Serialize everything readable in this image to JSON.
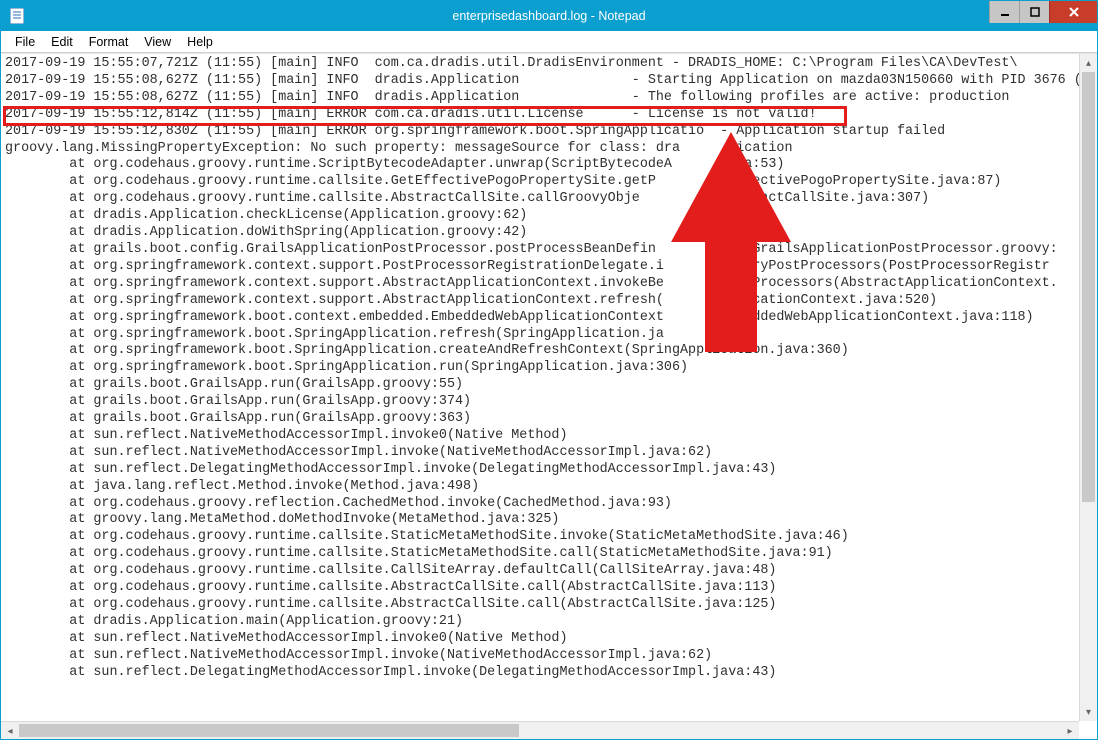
{
  "window": {
    "title": "enterprisedashboard.log - Notepad"
  },
  "menu": {
    "file": "File",
    "edit": "Edit",
    "format": "Format",
    "view": "View",
    "help": "Help"
  },
  "log": {
    "L1": "2017-09-19 15:55:07,721Z (11:55) [main] INFO  com.ca.dradis.util.DradisEnvironment - DRADIS_HOME: C:\\Program Files\\CA\\DevTest\\",
    "L2": "2017-09-19 15:55:08,627Z (11:55) [main] INFO  dradis.Application              - Starting Application on mazda03N150660 with PID 3676 (",
    "L3": "2017-09-19 15:55:08,627Z (11:55) [main] INFO  dradis.Application              - The following profiles are active: production",
    "L4": "2017-09-19 15:55:12,814Z (11:55) [main] ERROR com.ca.dradis.util.License      - License is not valid!",
    "L5": "2017-09-19 15:55:12,830Z (11:55) [main] ERROR org.springframework.boot.SpringApplicatio  - Application startup failed",
    "L6": "groovy.lang.MissingPropertyException: No such property: messageSource for class: dra      lication",
    "L7": "        at org.codehaus.groovy.runtime.ScriptBytecodeAdapter.unwrap(ScriptBytecodeA         a:53)",
    "L8": "        at org.codehaus.groovy.runtime.callsite.GetEffectivePogoPropertySite.getP            ectivePogoPropertySite.java:87)",
    "L9": "        at org.codehaus.groovy.runtime.callsite.AbstractCallSite.callGroovyObje              ractCallSite.java:307)",
    "L10": "        at dradis.Application.checkLicense(Application.groovy:62)",
    "L11": "        at dradis.Application.doWithSpring(Application.groovy:42)",
    "L12": "        at grails.boot.config.GrailsApplicationPostProcessor.postProcessBeanDefin           (GrailsApplicationPostProcessor.groovy:",
    "L13": "        at org.springframework.context.support.PostProcessorRegistrationDelegate.i          oryPostProcessors(PostProcessorRegistr",
    "L14": "        at org.springframework.context.support.AbstractApplicationContext.invokeBe          tProcessors(AbstractApplicationContext.",
    "L15": "        at org.springframework.context.support.AbstractApplicationContext.refresh(          icationContext.java:520)",
    "L16": "        at org.springframework.boot.context.embedded.EmbeddedWebApplicationContext          eddedWebApplicationContext.java:118)",
    "L17": "        at org.springframework.boot.SpringApplication.refresh(SpringApplication.ja",
    "L18": "        at org.springframework.boot.SpringApplication.createAndRefreshContext(SpringApplication.java:360)",
    "L19": "        at org.springframework.boot.SpringApplication.run(SpringApplication.java:306)",
    "L20": "        at grails.boot.GrailsApp.run(GrailsApp.groovy:55)",
    "L21": "        at grails.boot.GrailsApp.run(GrailsApp.groovy:374)",
    "L22": "        at grails.boot.GrailsApp.run(GrailsApp.groovy:363)",
    "L23": "        at sun.reflect.NativeMethodAccessorImpl.invoke0(Native Method)",
    "L24": "        at sun.reflect.NativeMethodAccessorImpl.invoke(NativeMethodAccessorImpl.java:62)",
    "L25": "        at sun.reflect.DelegatingMethodAccessorImpl.invoke(DelegatingMethodAccessorImpl.java:43)",
    "L26": "        at java.lang.reflect.Method.invoke(Method.java:498)",
    "L27": "        at org.codehaus.groovy.reflection.CachedMethod.invoke(CachedMethod.java:93)",
    "L28": "        at groovy.lang.MetaMethod.doMethodInvoke(MetaMethod.java:325)",
    "L29": "        at org.codehaus.groovy.runtime.callsite.StaticMetaMethodSite.invoke(StaticMetaMethodSite.java:46)",
    "L30": "        at org.codehaus.groovy.runtime.callsite.StaticMetaMethodSite.call(StaticMetaMethodSite.java:91)",
    "L31": "        at org.codehaus.groovy.runtime.callsite.CallSiteArray.defaultCall(CallSiteArray.java:48)",
    "L32": "        at org.codehaus.groovy.runtime.callsite.AbstractCallSite.call(AbstractCallSite.java:113)",
    "L33": "        at org.codehaus.groovy.runtime.callsite.AbstractCallSite.call(AbstractCallSite.java:125)",
    "L34": "        at dradis.Application.main(Application.groovy:21)",
    "L35": "        at sun.reflect.NativeMethodAccessorImpl.invoke0(Native Method)",
    "L36": "        at sun.reflect.NativeMethodAccessorImpl.invoke(NativeMethodAccessorImpl.java:62)",
    "L37": "        at sun.reflect.DelegatingMethodAccessorImpl.invoke(DelegatingMethodAccessorImpl.java:43)"
  }
}
